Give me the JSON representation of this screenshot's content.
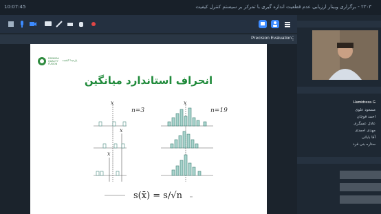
{
  "titlebar": {
    "time": "10:07:45",
    "title": "۲۳۰۳ - برگزاری وبینار ارزیابی عدم قطعیت اندازه گیری با تمرکز بر سیستم کنترل کیفیت"
  },
  "toolbar": {
    "icons": [
      "grid-icon",
      "mic-icon",
      "camera-icon",
      "chat-icon",
      "pen-icon",
      "eraser-icon",
      "hand-icon",
      "record-icon",
      "share-icon",
      "users-icon",
      "menu-icon"
    ]
  },
  "tab": {
    "label": "Precision Evaluation"
  },
  "slide": {
    "logo_lines": [
      "PARMIDA",
      "QUALITY",
      "FUSION"
    ],
    "logo_fa": "پارمیدا کیفیت",
    "title": "انحراف استاندارد میانگین",
    "label_n3": "n=3",
    "label_n19": "n=19",
    "xbar": "x",
    "formula": "s(x̄) = s/√n"
  },
  "panel": {
    "speaker": "Hamidreza G",
    "users": [
      "مسعود علوی",
      "احمد قوچان",
      "عادل عسگری",
      "مهدی احمدی",
      "آقا بابائی",
      "ستاره بنی فرد"
    ]
  },
  "colors": {
    "accent": "#1f8a3a",
    "bar": "#5fa6a0",
    "bg": "#1e2730"
  }
}
